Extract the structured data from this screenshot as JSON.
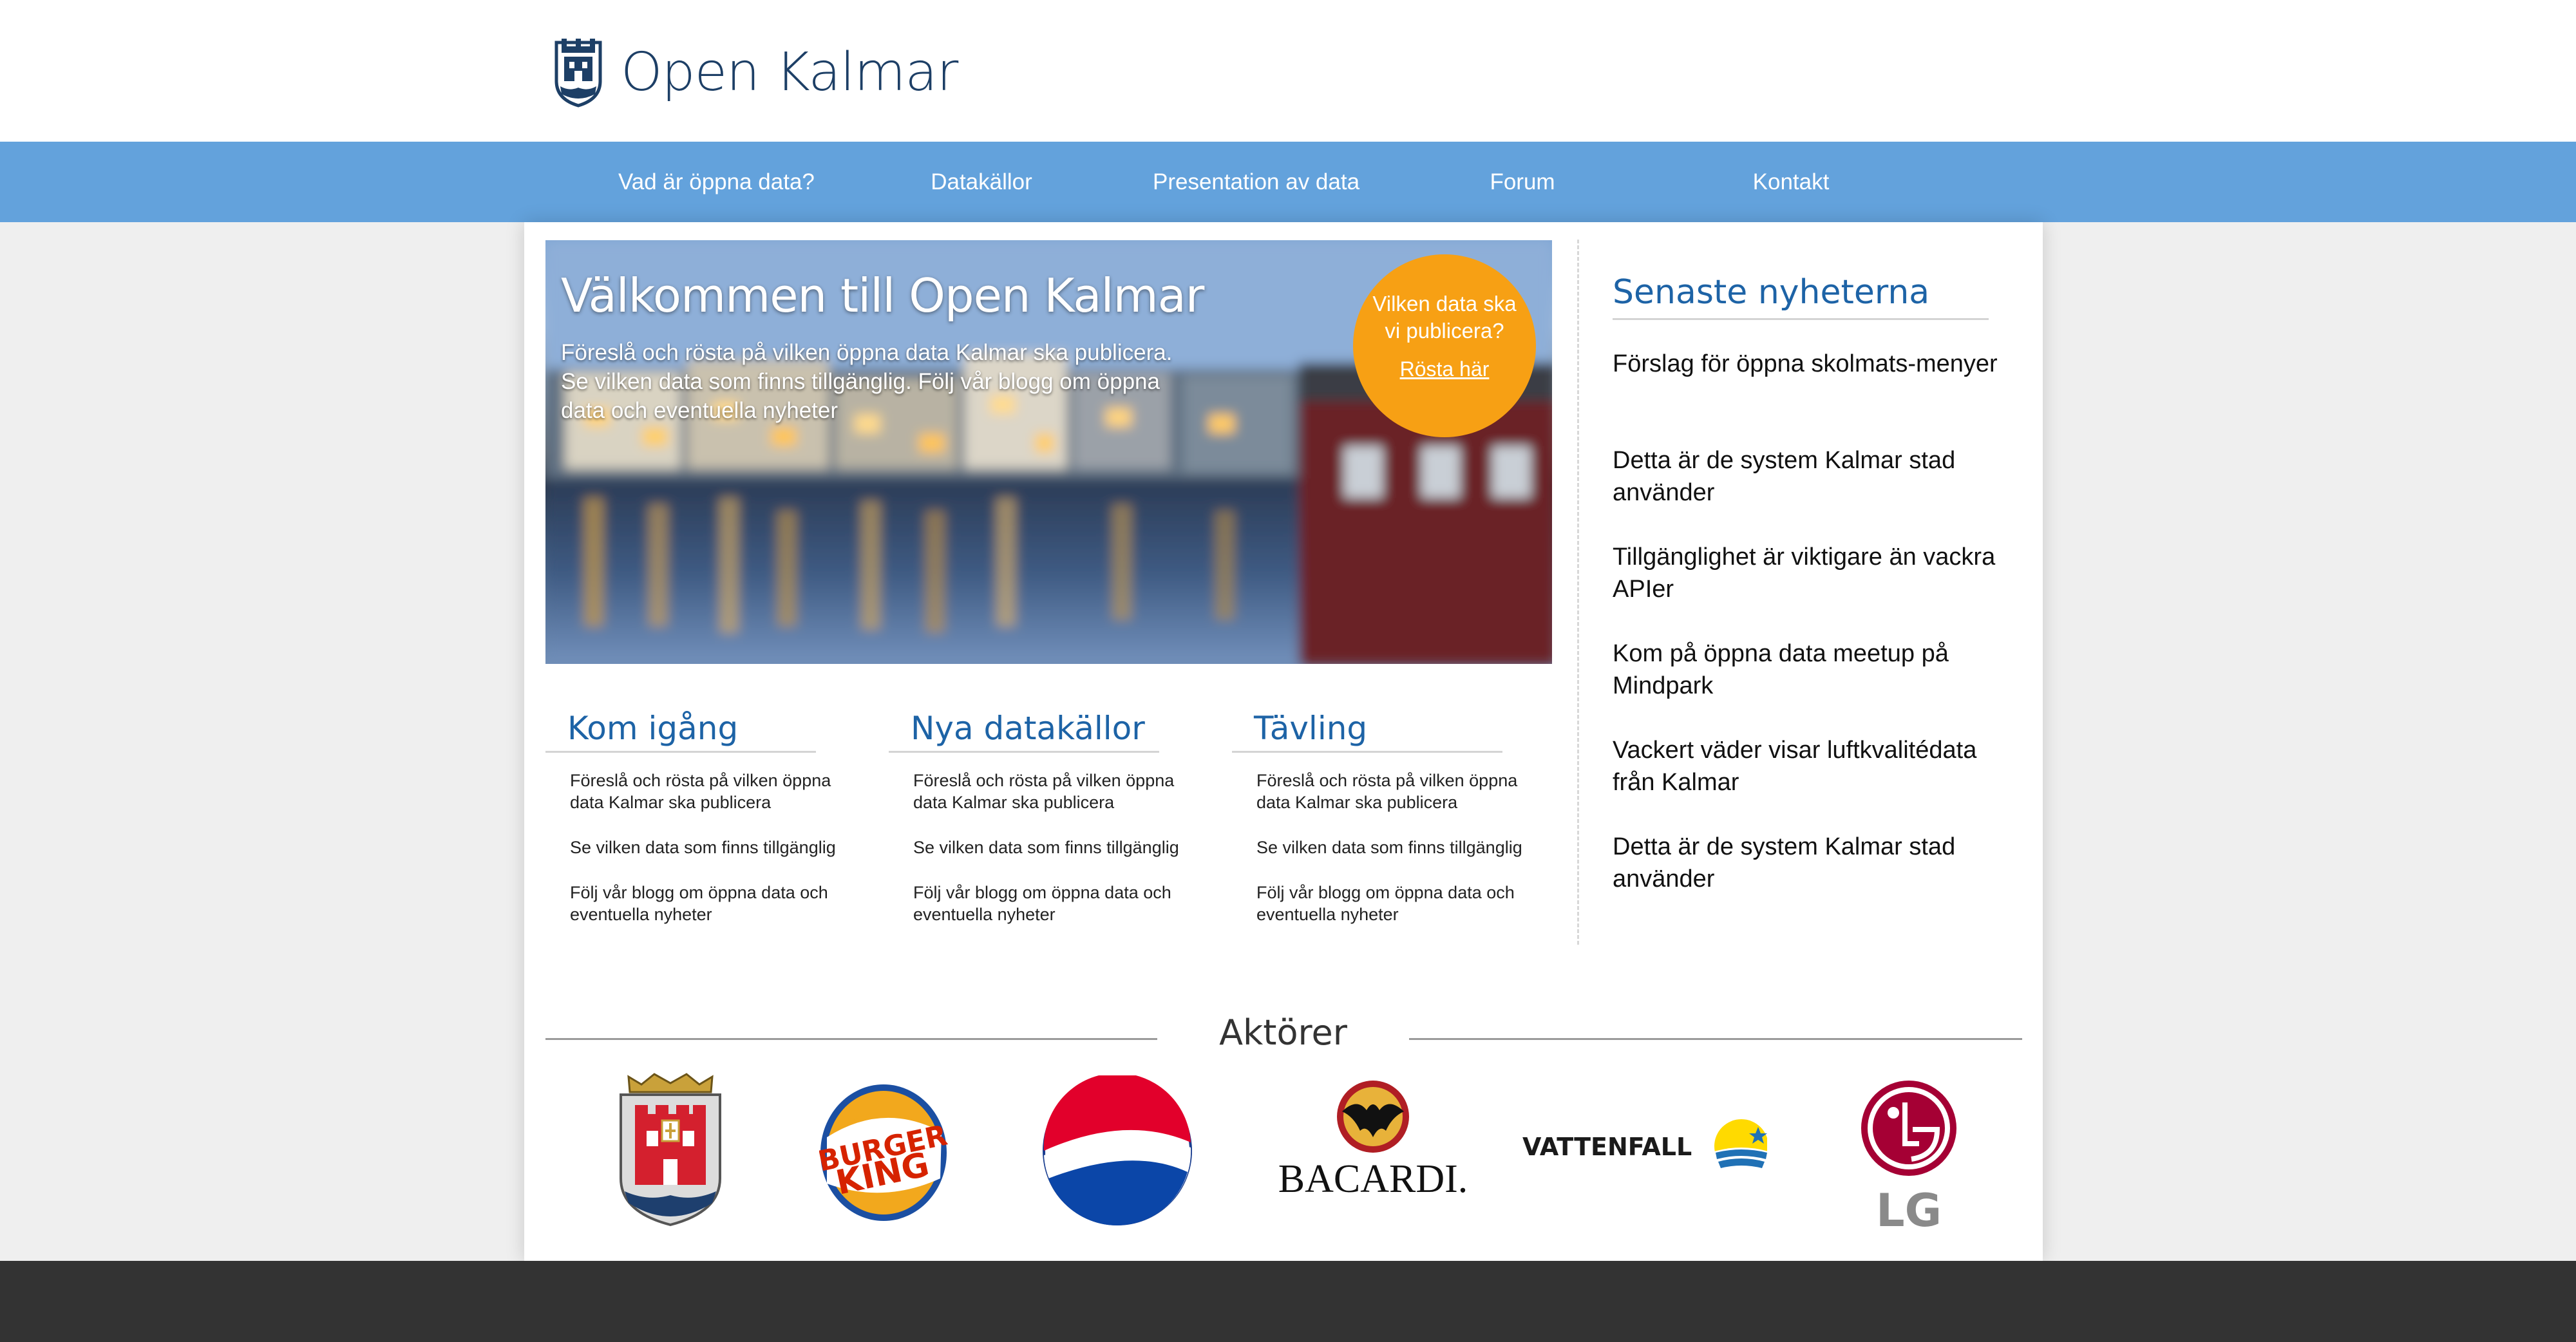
{
  "brand": {
    "name": "Open Kalmar"
  },
  "nav": {
    "items": [
      {
        "label": "Vad är öppna data?"
      },
      {
        "label": "Datakällor"
      },
      {
        "label": "Presentation av data"
      },
      {
        "label": "Forum"
      },
      {
        "label": "Kontakt"
      }
    ]
  },
  "hero": {
    "title": "Välkommen till Open Kalmar",
    "body": "Föreslå och rösta på vilken öppna data Kalmar ska publicera. Se vilken data som finns tillgänglig. Följ vår blogg om öppna data och eventuella nyheter",
    "vote_question": "Vilken data ska vi publicera?",
    "vote_link": "Rösta här"
  },
  "columns": [
    {
      "title": "Kom igång",
      "items": [
        "Föreslå och rösta på vilken öppna data Kalmar ska publicera",
        "Se vilken data som finns tillgänglig",
        "Följ vår blogg om öppna data och eventuella nyheter"
      ]
    },
    {
      "title": "Nya datakällor",
      "items": [
        "Föreslå och rösta på vilken öppna data Kalmar ska publicera",
        "Se vilken data som finns tillgänglig",
        "Följ vår blogg om öppna data och eventuella nyheter"
      ]
    },
    {
      "title": "Tävling",
      "items": [
        "Föreslå och rösta på vilken öppna data Kalmar ska publicera",
        "Se vilken data som finns tillgänglig",
        "Följ vår blogg om öppna data och eventuella nyheter"
      ]
    }
  ],
  "news": {
    "title": "Senaste nyheterna",
    "items": [
      "Förslag för öppna skolmats-menyer",
      "Detta är de system Kalmar stad använder",
      "Tillgänglighet är viktigare än vackra APIer",
      "Kom på öppna data meetup på Mindpark",
      "Vackert väder visar luftkvalitédata från Kalmar",
      "Detta är de system Kalmar stad använder"
    ]
  },
  "actors": {
    "title": "Aktörer",
    "logos": [
      {
        "icon": "kalmar-crest-icon"
      },
      {
        "icon": "burger-king-icon",
        "text": [
          "BURGER",
          "KING"
        ]
      },
      {
        "icon": "pepsi-icon"
      },
      {
        "icon": "bacardi-icon",
        "text": "BACARDI."
      },
      {
        "icon": "vattenfall-icon",
        "text": "VATTENFALL"
      },
      {
        "icon": "lg-icon",
        "text": "LG"
      }
    ]
  },
  "colors": {
    "nav": "#63a2dc",
    "accent_blue": "#1d63a6",
    "vote_orange": "#f7a014",
    "footer": "#333333"
  }
}
